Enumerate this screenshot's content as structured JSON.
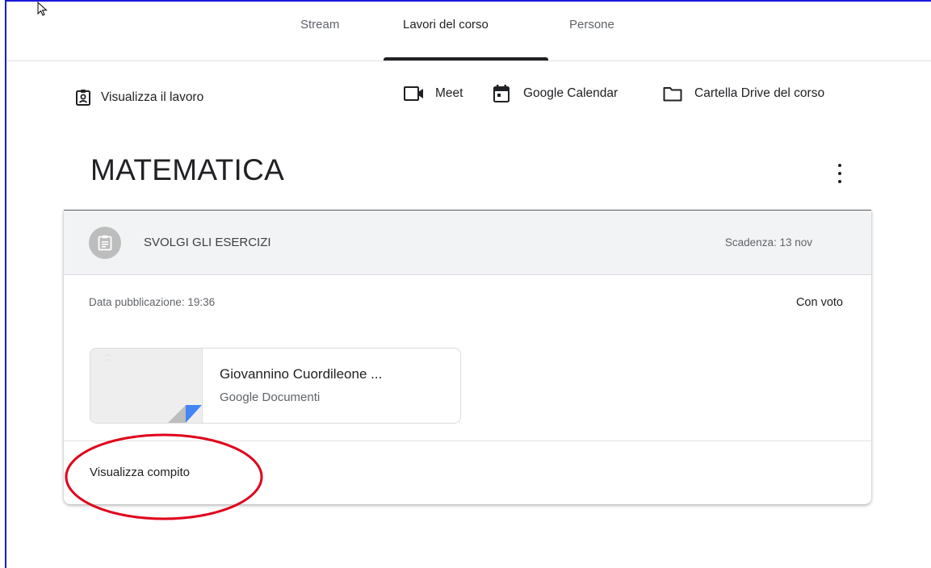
{
  "tabs": [
    {
      "label": "Stream"
    },
    {
      "label": "Lavori del corso",
      "active": true
    },
    {
      "label": "Persone"
    }
  ],
  "toolbar": {
    "view_work": "Visualizza il lavoro",
    "meet": "Meet",
    "calendar": "Google Calendar",
    "drive": "Cartella Drive del corso"
  },
  "topic": {
    "title": "MATEMATICA"
  },
  "assignment": {
    "title": "SVOLGI GLI ESERCIZI",
    "due": "Scadenza: 13 nov",
    "published": "Data pubblicazione: 19:36",
    "grading": "Con voto",
    "attachment": {
      "title": "Giovannino Cuordileone ...",
      "type": "Google Documenti"
    },
    "view_link": "Visualizza compito"
  },
  "colors": {
    "accent_blue": "#4285f4",
    "annotation_red": "#e0001a",
    "frame_blue": "#1a1ad6"
  }
}
